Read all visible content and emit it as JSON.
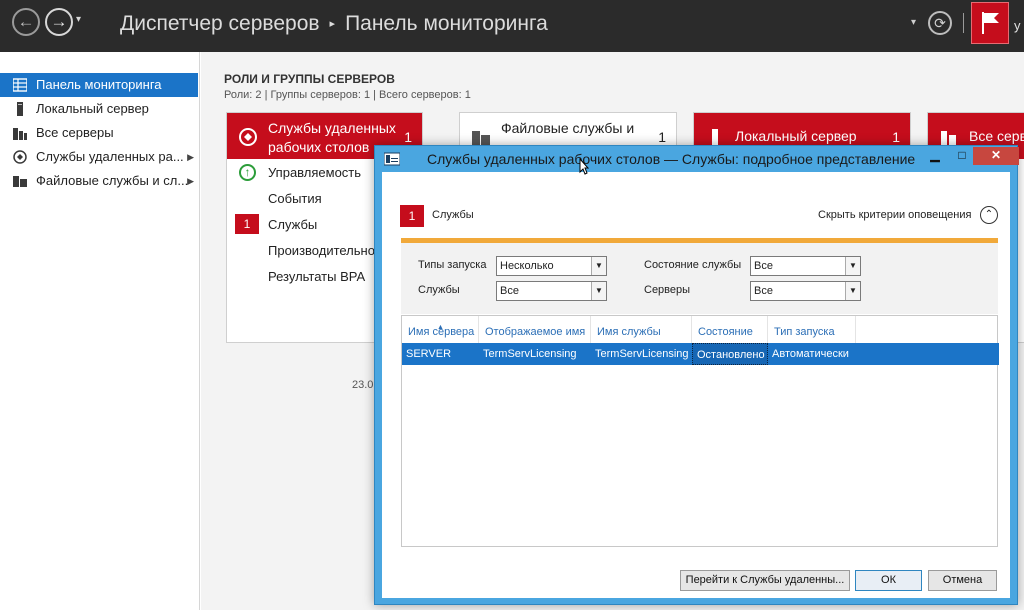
{
  "topbar": {
    "back_glyph": "←",
    "forward_glyph": "→",
    "dropdown_glyph": "▾",
    "breadcrumb": [
      "Диспетчер серверов",
      "Панель мониторинга"
    ],
    "breadcrumb_sep": "▸",
    "refresh_glyph": "⟳",
    "truncated_menu": "у"
  },
  "sidebar": {
    "items": [
      {
        "label": "Панель мониторинга",
        "icon": "dashboard-icon",
        "active": true
      },
      {
        "label": "Локальный сервер",
        "icon": "server-icon"
      },
      {
        "label": "Все серверы",
        "icon": "servers-icon"
      },
      {
        "label": "Службы удаленных ра...",
        "icon": "rds-icon",
        "expand": "▶"
      },
      {
        "label": "Файловые службы и сл...",
        "icon": "file-services-icon",
        "expand": "▶"
      }
    ]
  },
  "main": {
    "section_title": "РОЛИ И ГРУППЫ СЕРВЕРОВ",
    "section_sub": "Роли: 2 | Группы серверов: 1 | Всего серверов: 1",
    "tiles": [
      {
        "title_line1": "Службы удаленных",
        "title_line2": "рабочих столов",
        "count": "1",
        "rows": [
          "Управляемость",
          "События",
          "Службы",
          "Производительно",
          "Результаты BPA"
        ],
        "services_badge": "1",
        "date": "23.0"
      },
      {
        "title_line1": "Файловые службы и",
        "count": "1"
      },
      {
        "title_line1": "Локальный сервер",
        "count": "1"
      },
      {
        "title_line1": "Все серве"
      }
    ]
  },
  "dialog": {
    "title": "Службы удаленных рабочих столов — Службы: подробное представление",
    "min_glyph": "▁",
    "max_glyph": "□",
    "close_glyph": "✕",
    "badge": "1",
    "badge_label": "Службы",
    "hide_criteria": "Скрыть критерии оповещения",
    "collapse_glyph": "⌃",
    "filters": {
      "startup_types_label": "Типы запуска",
      "startup_types_value": "Несколько",
      "services_label": "Службы",
      "services_value": "Все",
      "service_state_label": "Состояние службы",
      "service_state_value": "Все",
      "servers_label": "Серверы",
      "servers_value": "Все"
    },
    "columns": [
      "Имя сервера",
      "Отображаемое имя",
      "Имя службы",
      "Состояние",
      "Тип запуска"
    ],
    "sort_glyph": "▲",
    "rows": [
      [
        "SERVER",
        "TermServLicensing",
        "TermServLicensing",
        "Остановлено",
        "Автоматически"
      ]
    ],
    "buttons": {
      "goto": "Перейти к Службы удаленны...",
      "ok": "ОК",
      "cancel": "Отмена"
    }
  },
  "colors": {
    "accent_red": "#c50d1c",
    "selection_blue": "#1b74c8",
    "dialog_frame": "#4aa6e0",
    "filter_bar": "#f1a93a"
  }
}
